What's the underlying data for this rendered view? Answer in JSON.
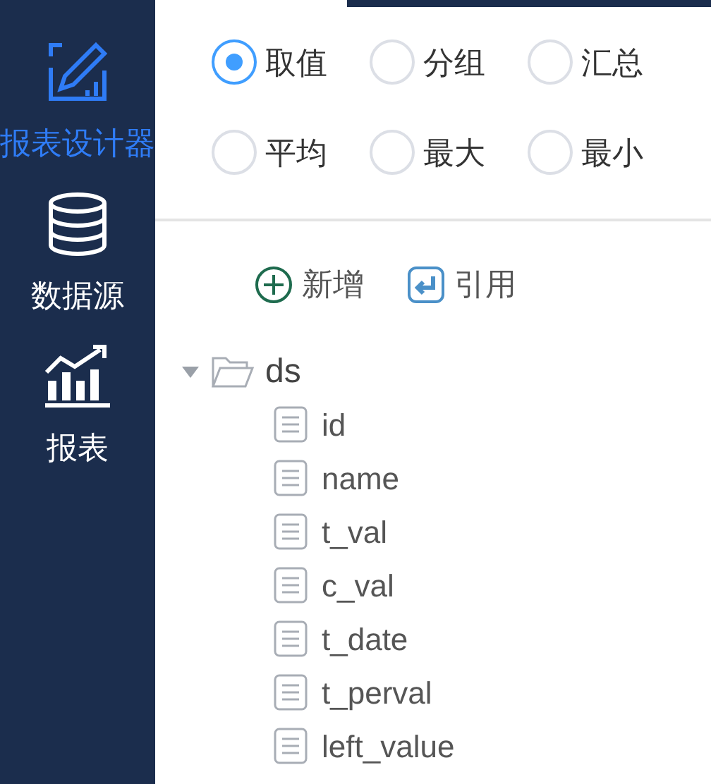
{
  "sidebar": {
    "items": [
      {
        "kind": "designer",
        "label": "报表设计器",
        "selected": true
      },
      {
        "kind": "datasource",
        "label": "数据源",
        "selected": false
      },
      {
        "kind": "report",
        "label": "报表",
        "selected": false
      }
    ]
  },
  "options": [
    {
      "label": "取值",
      "selected": true
    },
    {
      "label": "分组",
      "selected": false
    },
    {
      "label": "汇总",
      "selected": false
    },
    {
      "label": "平均",
      "selected": false
    },
    {
      "label": "最大",
      "selected": false
    },
    {
      "label": "最小",
      "selected": false
    }
  ],
  "actions": [
    {
      "kind": "add",
      "label": "新增"
    },
    {
      "kind": "reference",
      "label": "引用"
    }
  ],
  "tree": {
    "label": "ds",
    "expanded": true,
    "children": [
      {
        "label": "id"
      },
      {
        "label": "name"
      },
      {
        "label": "t_val"
      },
      {
        "label": "c_val"
      },
      {
        "label": "t_date"
      },
      {
        "label": "t_perval"
      },
      {
        "label": "left_value"
      }
    ]
  }
}
